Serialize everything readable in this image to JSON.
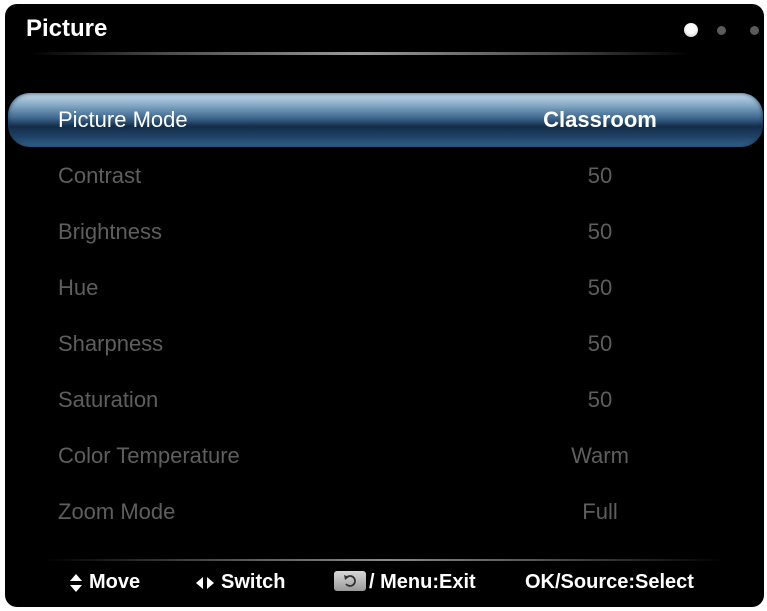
{
  "header": {
    "title": "Picture",
    "page_dots": 3,
    "active_page": 1
  },
  "menu": {
    "items": [
      {
        "label": "Picture Mode",
        "value": "Classroom",
        "selected": true
      },
      {
        "label": "Contrast",
        "value": "50"
      },
      {
        "label": "Brightness",
        "value": "50"
      },
      {
        "label": "Hue",
        "value": "50"
      },
      {
        "label": "Sharpness",
        "value": "50"
      },
      {
        "label": "Saturation",
        "value": "50"
      },
      {
        "label": "Color Temperature",
        "value": "Warm"
      },
      {
        "label": "Zoom Mode",
        "value": "Full"
      }
    ]
  },
  "footer": {
    "move_label": "Move",
    "switch_label": "Switch",
    "exit_label": "/ Menu:Exit",
    "select_label": "OK/Source:Select"
  },
  "colors": {
    "background": "#000000",
    "selected_highlight": "#3f6890",
    "inactive_text": "#5e5e5e",
    "active_text": "#ffffff"
  }
}
